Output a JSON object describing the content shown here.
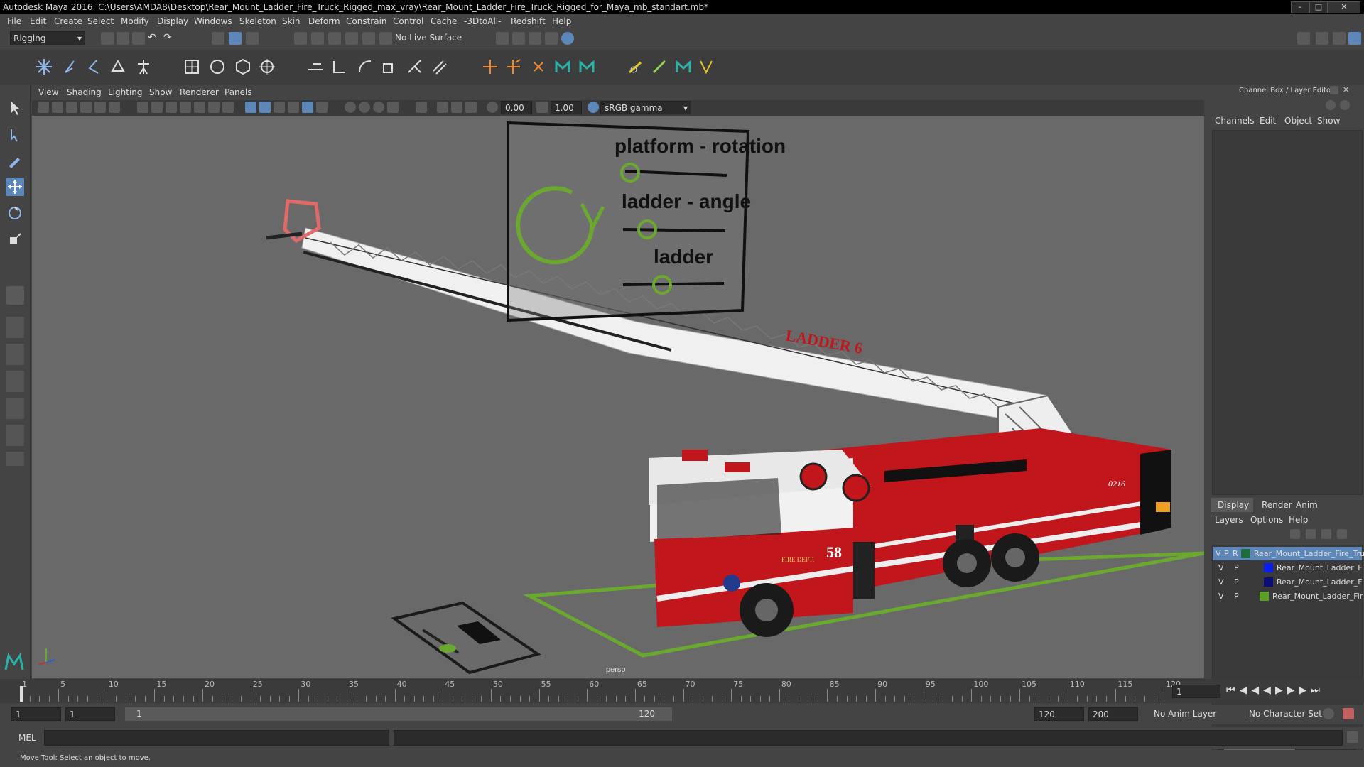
{
  "window": {
    "title": "Autodesk Maya 2016: C:\\Users\\AMDA8\\Desktop\\Rear_Mount_Ladder_Fire_Truck_Rigged_max_vray\\Rear_Mount_Ladder_Fire_Truck_Rigged_for_Maya_mb_standart.mb*"
  },
  "menubar": [
    "File",
    "Edit",
    "Create",
    "Select",
    "Modify",
    "Display",
    "Windows",
    "Skeleton",
    "Skin",
    "Deform",
    "Constrain",
    "Control",
    "Cache",
    "-3DtoAll-",
    "Redshift",
    "Help"
  ],
  "status": {
    "mode": "Rigging",
    "live_surface": "No Live Surface"
  },
  "viewport_menu": [
    "View",
    "Shading",
    "Lighting",
    "Show",
    "Renderer",
    "Panels"
  ],
  "viewport_toolbar": {
    "exposure": "0.00",
    "gamma": "1.00",
    "color_space": "sRGB gamma"
  },
  "viewport": {
    "camera": "persp",
    "control_labels": {
      "platform": "platform - rotation",
      "angle": "ladder - angle",
      "ladder": "ladder"
    },
    "truck_text": {
      "ladder_name": "LADDER 6",
      "unit_number": "58",
      "dept": "FIRE DEPT.",
      "rear_number": "0216"
    },
    "colors": {
      "rig_green": "#6aa82f",
      "truck_red": "#c0161c",
      "ladder_white": "#eeeeee",
      "bg": "#696969"
    }
  },
  "channel_box": {
    "header": "Channel Box / Layer Editor",
    "menu": [
      "Channels",
      "Edit",
      "Object",
      "Show"
    ]
  },
  "layer_editor": {
    "tabs": [
      "Display",
      "Render",
      "Anim"
    ],
    "menu": [
      "Layers",
      "Options",
      "Help"
    ],
    "layers": [
      {
        "v": "V",
        "p": "P",
        "r": "R",
        "color": "#1e6e3c",
        "name": "Rear_Mount_Ladder_Fire_Tru",
        "selected": true
      },
      {
        "v": "V",
        "p": "P",
        "r": "",
        "color": "#0a1ef0",
        "name": "Rear_Mount_Ladder_F",
        "selected": false
      },
      {
        "v": "V",
        "p": "P",
        "r": "",
        "color": "#0a0f78",
        "name": "Rear_Mount_Ladder_F",
        "selected": false
      },
      {
        "v": "V",
        "p": "P",
        "r": "",
        "color": "#5aa028",
        "name": "Rear_Mount_Ladder_Fir",
        "selected": false
      }
    ]
  },
  "timeline": {
    "ticks": [
      "1",
      "5",
      "10",
      "15",
      "20",
      "25",
      "30",
      "35",
      "40",
      "45",
      "50",
      "55",
      "60",
      "65",
      "70",
      "75",
      "80",
      "85",
      "90",
      "95",
      "100",
      "105",
      "110",
      "115",
      "120"
    ],
    "current_frame": "1",
    "current_time_field": "1"
  },
  "range": {
    "start": "1",
    "playback_start": "1",
    "slider_start": "1",
    "slider_end": "120",
    "playback_end": "120",
    "end": "200",
    "anim_layer": "No Anim Layer",
    "character_set": "No Character Set"
  },
  "command": {
    "language": "MEL"
  },
  "help_line": "Move Tool: Select an object to move."
}
